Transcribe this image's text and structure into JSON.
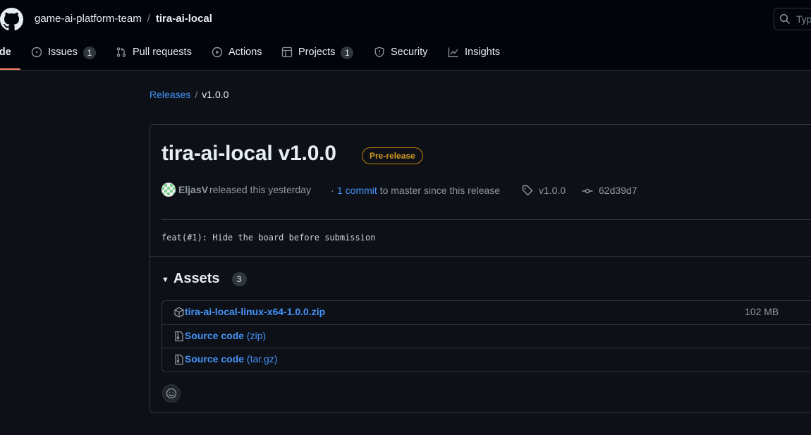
{
  "header": {
    "owner": "game-ai-platform-team",
    "separator": "/",
    "repo": "tira-ai-local",
    "search_placeholder": "Typ"
  },
  "tabs": [
    {
      "label": "Code",
      "visible_label": "ode",
      "icon": "code-icon",
      "selected": true
    },
    {
      "label": "Issues",
      "icon": "issue-opened-icon",
      "count": "1"
    },
    {
      "label": "Pull requests",
      "icon": "git-pull-request-icon"
    },
    {
      "label": "Actions",
      "icon": "play-icon"
    },
    {
      "label": "Projects",
      "icon": "table-icon",
      "count": "1"
    },
    {
      "label": "Security",
      "icon": "shield-icon"
    },
    {
      "label": "Insights",
      "icon": "graph-icon"
    }
  ],
  "breadcrumb": {
    "releases": "Releases",
    "separator": "/",
    "current": "v1.0.0"
  },
  "release": {
    "title": "tira-ai-local v1.0.0",
    "badge": "Pre-release",
    "author": "EljasV",
    "released_text": "released this yesterday",
    "dot": "·",
    "commits_link": "1 commit",
    "commits_suffix": "to master since this release",
    "tag": "v1.0.0",
    "commit_sha": "62d39d7",
    "body": "feat(#1): Hide the board before submission"
  },
  "assets": {
    "label": "Assets",
    "count": "3",
    "items": [
      {
        "name": "tira-ai-local-linux-x64-1.0.0.zip",
        "suffix": "",
        "size": "102 MB",
        "icon": "package-icon"
      },
      {
        "name": "Source code",
        "suffix": "(zip)",
        "size": "",
        "icon": "file-zip-icon"
      },
      {
        "name": "Source code",
        "suffix": "(tar.gz)",
        "size": "",
        "icon": "file-zip-icon"
      }
    ]
  },
  "colors": {
    "background": "#0d1117",
    "header": "#010409",
    "link": "#4493f8",
    "prerelease": "#d29922",
    "selected_tab_underline": "#f78166"
  }
}
